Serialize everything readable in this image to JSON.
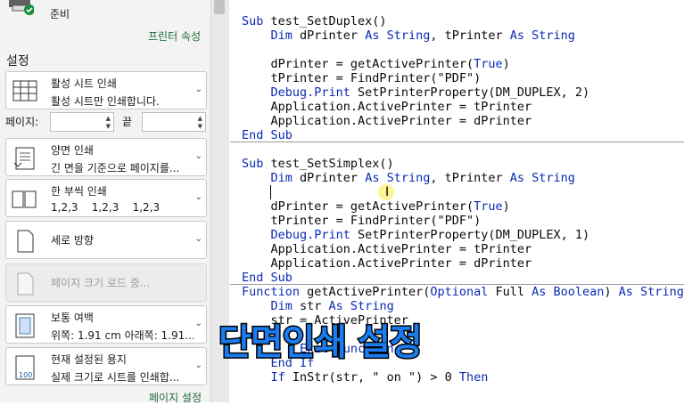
{
  "printer": {
    "status": "준비",
    "properties_link": "프린터 속성",
    "icon": "printer-ready-icon"
  },
  "settings": {
    "title": "설정",
    "print_what": {
      "title": "활성 시트 인쇄",
      "sub": "활성 시트만 인쇄합니다.",
      "icon": "sheet-grid-icon"
    },
    "pages": {
      "label": "페이지:",
      "to_label": "끝",
      "from_value": "",
      "to_value": ""
    },
    "duplex": {
      "title": "양면 인쇄",
      "sub": "긴 면을 기준으로 페이지를...",
      "icon": "duplex-icon"
    },
    "collate": {
      "title": "한 부씩 인쇄",
      "sub": "1,2,3    1,2,3    1,2,3",
      "icon": "collate-icon"
    },
    "orientation": {
      "title": "세로 방향",
      "icon": "portrait-icon"
    },
    "paper_size": {
      "title": "페이지 크기 로드 중...",
      "icon": "paper-icon"
    },
    "margins": {
      "title": "보통 여백",
      "sub": "위쪽: 1.91 cm 아래쪽: 1.91...",
      "icon": "margins-icon"
    },
    "scaling": {
      "title": "현재 설정된 용지",
      "sub": "실제 크기로 시트를 인쇄합...",
      "icon": "scale-100-icon"
    },
    "page_setup_link": "페이지 설정"
  },
  "code": {
    "block1": [
      [
        [
          "kw",
          "Sub "
        ],
        [
          "tx",
          "test_SetDuplex()"
        ]
      ],
      [
        [
          "kw",
          "    Dim "
        ],
        [
          "tx",
          "dPrinter "
        ],
        [
          "kw",
          "As String"
        ],
        [
          "tx",
          ", tPrinter "
        ],
        [
          "kw",
          "As String"
        ]
      ],
      [
        [
          "tx",
          ""
        ]
      ],
      [
        [
          "tx",
          "    dPrinter = getActivePrinter("
        ],
        [
          "kw",
          "True"
        ],
        [
          "tx",
          ")"
        ]
      ],
      [
        [
          "tx",
          "    tPrinter = FindPrinter(\"PDF\")"
        ]
      ],
      [
        [
          "kw",
          "    Debug.Print "
        ],
        [
          "tx",
          "SetPrinterProperty(DM_DUPLEX, 2)"
        ]
      ],
      [
        [
          "tx",
          "    Application.ActivePrinter = tPrinter"
        ]
      ],
      [
        [
          "tx",
          "    Application.ActivePrinter = dPrinter"
        ]
      ],
      [
        [
          "kw",
          "End Sub"
        ]
      ]
    ],
    "block2": [
      [
        [
          "kw",
          "Sub "
        ],
        [
          "tx",
          "test_SetSimplex()"
        ]
      ],
      [
        [
          "kw",
          "    Dim "
        ],
        [
          "tx",
          "dPrinter "
        ],
        [
          "kw",
          "As String"
        ],
        [
          "tx",
          ", tPrinter "
        ],
        [
          "kw",
          "As String"
        ]
      ],
      [
        [
          "tx",
          ""
        ]
      ],
      [
        [
          "tx",
          "    dPrinter = getActivePrinter("
        ],
        [
          "kw",
          "True"
        ],
        [
          "tx",
          ")"
        ]
      ],
      [
        [
          "tx",
          "    tPrinter = FindPrinter(\"PDF\")"
        ]
      ],
      [
        [
          "kw",
          "    Debug.Print "
        ],
        [
          "tx",
          "SetPrinterProperty(DM_DUPLEX, 1)"
        ]
      ],
      [
        [
          "tx",
          "    Application.ActivePrinter = tPrinter"
        ]
      ],
      [
        [
          "tx",
          "    Application.ActivePrinter = dPrinter"
        ]
      ],
      [
        [
          "kw",
          "End Sub"
        ]
      ]
    ],
    "block3": [
      [
        [
          "kw",
          "Function "
        ],
        [
          "tx",
          "getActivePrinter("
        ],
        [
          "kw",
          "Optional "
        ],
        [
          "tx",
          "Full "
        ],
        [
          "kw",
          "As Boolean"
        ],
        [
          "tx",
          ") "
        ],
        [
          "kw",
          "As String"
        ]
      ],
      [
        [
          "kw",
          "    Dim "
        ],
        [
          "tx",
          "str "
        ],
        [
          "kw",
          "As String"
        ]
      ],
      [
        [
          "tx",
          "    str = ActivePrinter"
        ]
      ],
      [
        [
          "tx",
          "    "
        ]
      ],
      [
        [
          "kw",
          "        Exit Function"
        ]
      ],
      [
        [
          "kw",
          "    End If"
        ]
      ],
      [
        [
          "kw",
          "    If "
        ],
        [
          "tx",
          "InStr(str, \" on \") > 0 "
        ],
        [
          "kw",
          "Then"
        ]
      ]
    ]
  },
  "overlay_caption": "단면인쇄 설정"
}
